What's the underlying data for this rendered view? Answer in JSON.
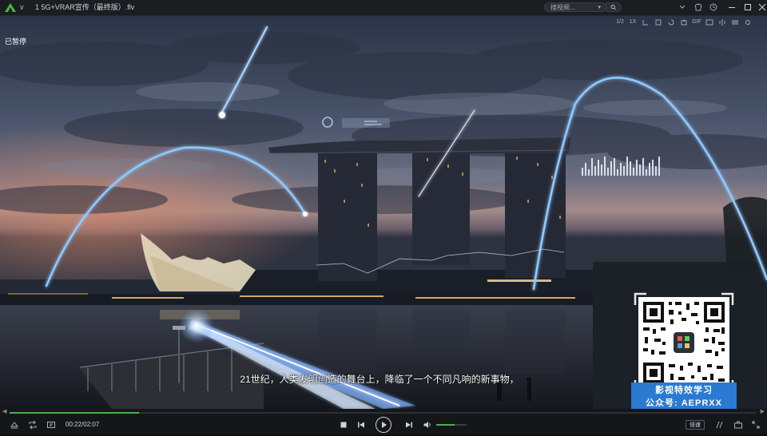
{
  "window": {
    "title": "1 5G+VRAR宣传（最终版）.flv",
    "search_placeholder": "搜视频..."
  },
  "titlebar_icons": [
    "menu-arrow-icon",
    "shirt-icon",
    "gift-icon",
    "history-icon",
    "minimize-icon",
    "maximize-icon",
    "close-icon"
  ],
  "toolstrip": {
    "items": [
      "1/2",
      "1X",
      "",
      "",
      "",
      "",
      "GIF",
      "",
      "",
      "",
      ""
    ]
  },
  "status": {
    "paused_label": "已暂停"
  },
  "subtitle": "21世纪，人类发明创造的舞台上，降临了一个不同凡响的新事物，",
  "promo": {
    "line1": "影视特效学习",
    "line2": "公众号:  AEPRXX"
  },
  "playback": {
    "current_time": "00:22",
    "total_time": "02:07",
    "time_display": "00:22/02:07",
    "progress_fraction": 0.173,
    "volume_fraction": 0.6,
    "speed_label": "倍速"
  },
  "colors": {
    "accent": "#4caf50",
    "promo_bg": "#2a7ad1",
    "ribbon_glow": "#8fc8ff"
  }
}
